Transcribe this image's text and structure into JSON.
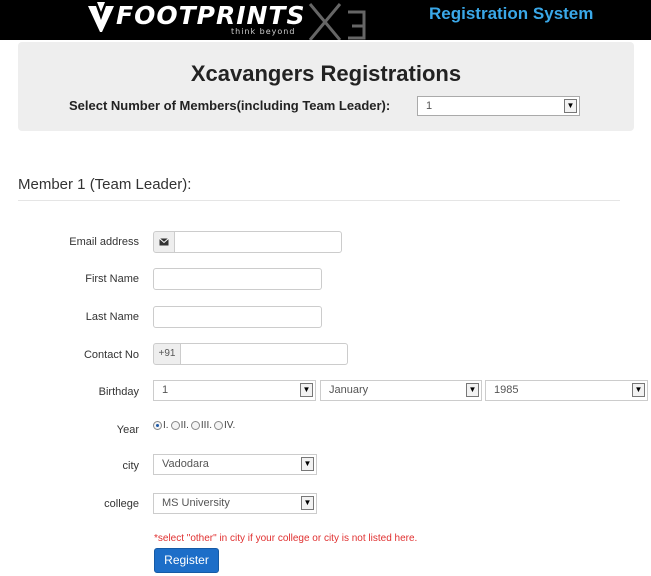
{
  "header": {
    "logo_text": "FOOTPRINTS",
    "logo_tagline": "think beyond",
    "system_title": "Registration System"
  },
  "panel": {
    "title": "Xcavangers  Registrations",
    "members_label": "Select Number of Members(including Team Leader):",
    "members_value": "1"
  },
  "section": {
    "title": "Member 1 (Team Leader):"
  },
  "form": {
    "email_label": "Email address",
    "email_value": "",
    "first_name_label": "First Name",
    "first_name_value": "",
    "last_name_label": "Last Name",
    "last_name_value": "",
    "contact_label": "Contact No",
    "contact_prefix": "+91",
    "contact_value": "",
    "birthday_label": "Birthday",
    "birthday_day": "1",
    "birthday_month": "January",
    "birthday_year": "1985",
    "year_label": "Year",
    "year_options": [
      "I.",
      "II.",
      "III.",
      "IV."
    ],
    "year_selected": "I.",
    "city_label": "city",
    "city_value": "Vadodara",
    "college_label": "college",
    "college_value": "MS University",
    "note": "*select \"other\" in city if your college or city is not listed here.",
    "register_label": "Register"
  },
  "colors": {
    "accent": "#1d6ec8",
    "title_blue": "#3aa8e8",
    "note_red": "#e03030"
  }
}
